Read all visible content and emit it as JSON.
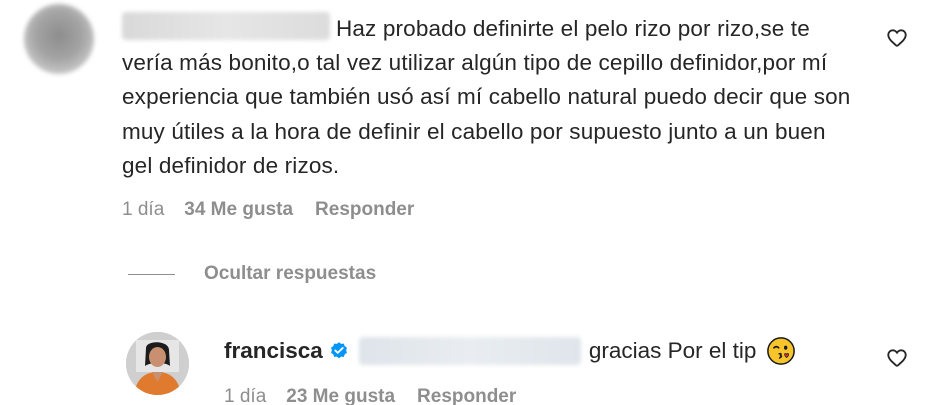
{
  "comment": {
    "text_line1": "Haz probado definirte el pelo rizo por rizo,se",
    "text_rest": "te vería más bonito,o tal vez utilizar algún tipo de cepillo definidor,por mí experiencia que también usó así mí cabello natural puedo decir que son muy útiles a la hora de definir el cabello por supuesto junto a un buen gel definidor de rizos.",
    "time": "1 día",
    "likes": "34 Me gusta",
    "reply_label": "Responder",
    "like_icon": "heart-outline-icon"
  },
  "replies_toggle": {
    "label": "Ocultar respuestas"
  },
  "reply": {
    "username": "francisca",
    "verified_icon": "verified-badge-icon",
    "text": "gracias Por el tip",
    "emoji": "face-blowing-kiss-emoji",
    "time": "1 día",
    "likes": "23 Me gusta",
    "reply_label": "Responder",
    "like_icon": "heart-outline-icon"
  },
  "colors": {
    "text": "#262626",
    "secondary": "#8e8e8e",
    "verified": "#0095f6"
  }
}
